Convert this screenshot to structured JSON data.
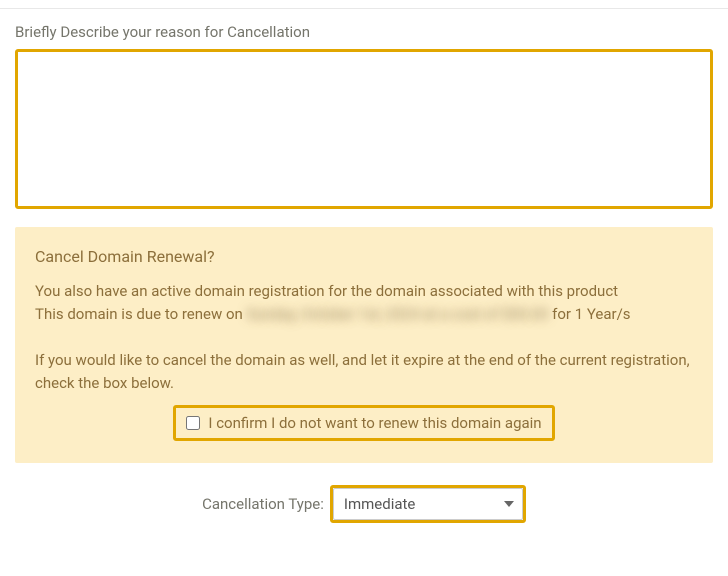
{
  "reason": {
    "label": "Briefly Describe your reason for Cancellation",
    "value": ""
  },
  "panel": {
    "title": "Cancel Domain Renewal?",
    "line1": "You also have an active domain registration for the domain associated with this product",
    "line2_prefix": "This domain is due to renew on ",
    "line2_blurred": "Sunday, October 1st, 2024 at a cost of $00.00",
    "line2_suffix": " for 1 Year/s",
    "prompt": "If you would like to cancel the domain as well, and let it expire at the end of the current registration, check the box below.",
    "confirm_label": "I confirm I do not want to renew this domain again"
  },
  "cancellation_type": {
    "label": "Cancellation Type:",
    "selected": "Immediate",
    "options": [
      "Immediate"
    ]
  }
}
